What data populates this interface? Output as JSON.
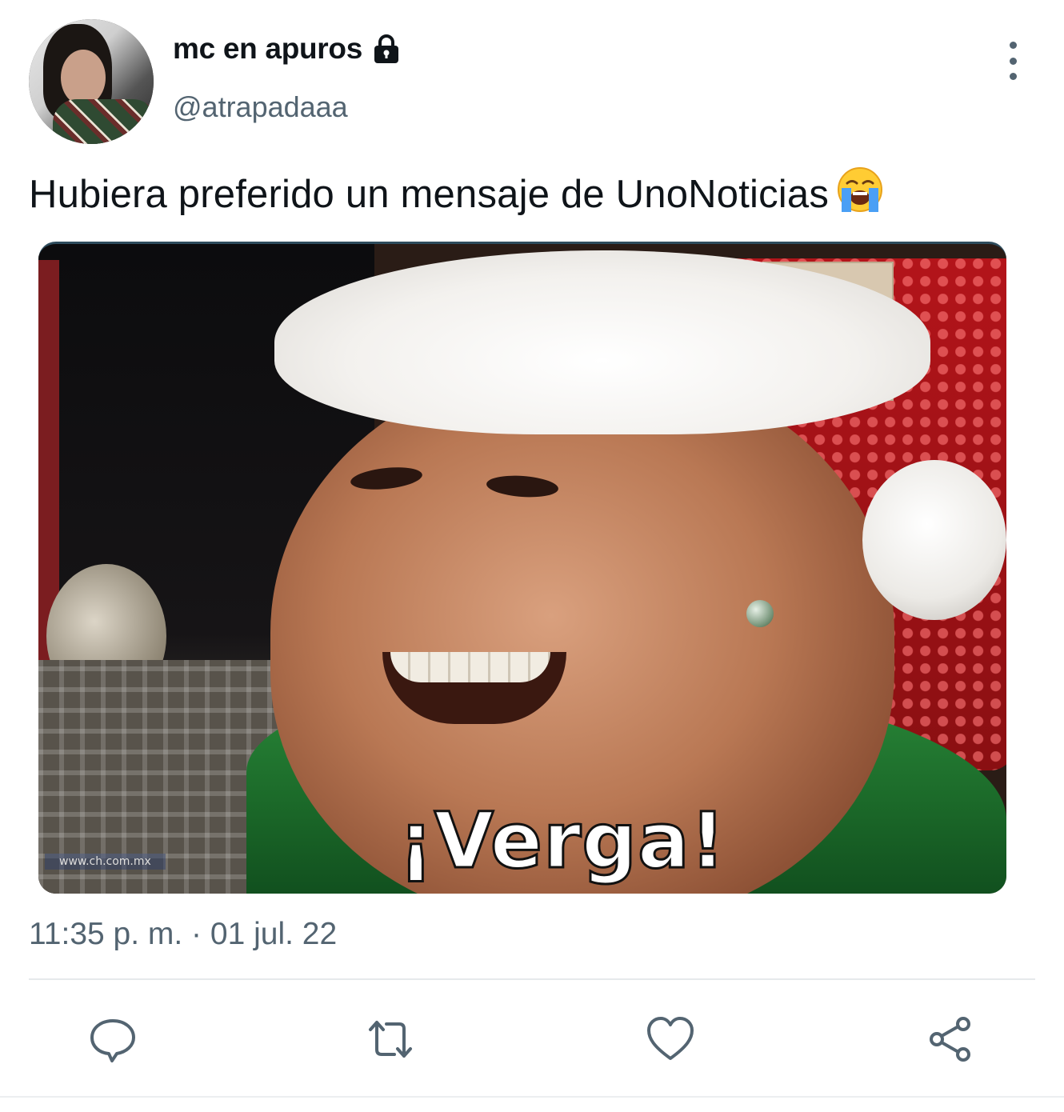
{
  "author": {
    "display_name": "mc en apuros",
    "handle": "@atrapadaaa",
    "protected_icon": "lock-icon"
  },
  "tweet": {
    "text": "Hubiera preferido un mensaje de UnoNoticias",
    "emoji": "loudly-crying-face",
    "timestamp": "11:35 p. m. · 01 jul. 22"
  },
  "media": {
    "caption": "¡Verga!",
    "watermark": "www.ch.com.mx"
  },
  "actions": [
    {
      "name": "reply",
      "icon": "reply-icon"
    },
    {
      "name": "retweet",
      "icon": "retweet-icon"
    },
    {
      "name": "like",
      "icon": "heart-icon"
    },
    {
      "name": "share",
      "icon": "share-icon"
    }
  ],
  "colors": {
    "text_primary": "#0f1419",
    "text_secondary": "#536471",
    "divider": "#e6e9eb"
  }
}
